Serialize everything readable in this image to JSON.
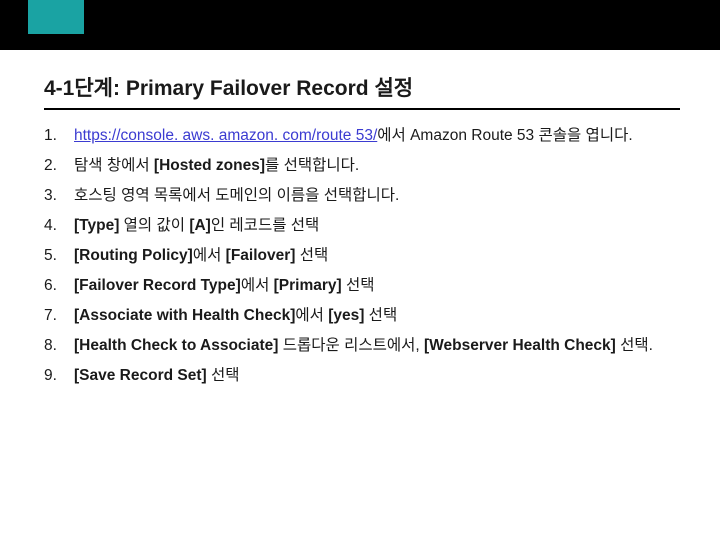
{
  "title": {
    "prefix_bold": "4-1단계",
    "colon": ": ",
    "rest": "Primary Failover Record ",
    "suffix_bold": "설정"
  },
  "steps": [
    {
      "link": "https://console. aws. amazon. com/route 53/",
      "after_link": "에서 Amazon Route 53 콘솔을 엽니다."
    },
    {
      "pre": "탐색 창에서 ",
      "bold1": "[Hosted zones]",
      "post": "를 선택합니다."
    },
    {
      "text": "호스팅 영역 목록에서 도메인의 이름을 선택합니다."
    },
    {
      "bold1": "[Type]",
      "mid": " 열의 값이 ",
      "bold2": "[A]",
      "post": "인 레코드를 선택"
    },
    {
      "bold1": "[Routing Policy]",
      "mid": "에서 ",
      "bold2": "[Failover]",
      "post": " 선택"
    },
    {
      "bold1": "[Failover Record Type]",
      "mid": "에서 ",
      "bold2": "[Primary]",
      "post": " 선택"
    },
    {
      "bold1": "[Associate with Health Check]",
      "mid": "에서 ",
      "bold2": "[yes]",
      "post": " 선택"
    },
    {
      "bold1": "[Health Check to Associate]",
      "mid": " 드롭다운 리스트에서, ",
      "bold2": "[Webserver Health Check]",
      "post": " 선택."
    },
    {
      "bold1": "[Save Record Set]",
      "post": " 선택"
    }
  ]
}
